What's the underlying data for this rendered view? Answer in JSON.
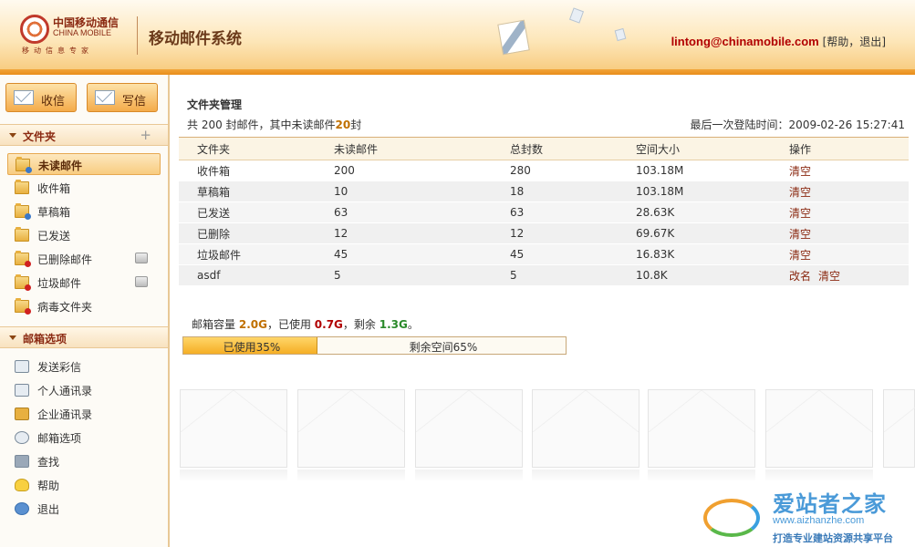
{
  "header": {
    "logo_cn": "中国移动通信",
    "logo_en": "CHINA MOBILE",
    "logo_sub": "移动信息专家",
    "system_title": "移动邮件系统",
    "user_email": "lintong@chinamobile.com",
    "bracket_open": "[",
    "help_label": "帮助",
    "separator": "，",
    "logout_label": "退出",
    "bracket_close": "]"
  },
  "sidebar": {
    "inbox_button": "收信",
    "compose_button": "写信",
    "folders_section": "文件夹",
    "add_symbol": "+",
    "folders": [
      {
        "label": "未读邮件"
      },
      {
        "label": "收件箱"
      },
      {
        "label": "草稿箱"
      },
      {
        "label": "已发送"
      },
      {
        "label": "已删除邮件"
      },
      {
        "label": "垃圾邮件"
      },
      {
        "label": "病毒文件夹"
      }
    ],
    "options_section": "邮箱选项",
    "tools": [
      {
        "label": "发送彩信"
      },
      {
        "label": "个人通讯录"
      },
      {
        "label": "企业通讯录"
      },
      {
        "label": "邮箱选项"
      },
      {
        "label": "查找"
      },
      {
        "label": "帮助"
      },
      {
        "label": "退出"
      }
    ]
  },
  "main": {
    "title": "文件夹管理",
    "summary_prefix": "共 200 封邮件，其中未读邮件",
    "summary_unread": "20",
    "summary_suffix": "封",
    "last_login_label": "最后一次登陆时间：",
    "last_login_value": "2009-02-26 15:27:41",
    "table": {
      "headers": [
        "文件夹",
        "未读邮件",
        "总封数",
        "空间大小",
        "操作"
      ],
      "rows": [
        {
          "folder": "收件箱",
          "unread": "200",
          "total": "280",
          "size": "103.18M",
          "op1": "清空",
          "op2": ""
        },
        {
          "folder": "草稿箱",
          "unread": "10",
          "total": "18",
          "size": "103.18M",
          "op1": "清空",
          "op2": ""
        },
        {
          "folder": "已发送",
          "unread": "63",
          "total": "63",
          "size": "28.63K",
          "op1": "清空",
          "op2": ""
        },
        {
          "folder": "已删除",
          "unread": "12",
          "total": "12",
          "size": "69.67K",
          "op1": "清空",
          "op2": ""
        },
        {
          "folder": "垃圾邮件",
          "unread": "45",
          "total": "45",
          "size": "16.83K",
          "op1": "清空",
          "op2": ""
        },
        {
          "folder": "asdf",
          "unread": "5",
          "total": "5",
          "size": "10.8K",
          "op1": "改名",
          "op2": "清空"
        }
      ]
    },
    "quota": {
      "label": "邮箱容量",
      "total": "2.0G",
      "used_label": "，已使用",
      "used": "0.7G",
      "free_label": "，剩余",
      "free": "1.3G",
      "end": "。",
      "used_percent": 35,
      "bar_used_text": "已使用35%",
      "bar_free_text": "剩余空间65%"
    }
  },
  "watermark": {
    "title": "爱站者之家",
    "url": "www.aizhanzhe.com",
    "slogan": "打造专业建站资源共享平台"
  },
  "colors": {
    "accent": "#f4ab4a",
    "brand_red": "#b10000",
    "link": "#8b2a12"
  }
}
